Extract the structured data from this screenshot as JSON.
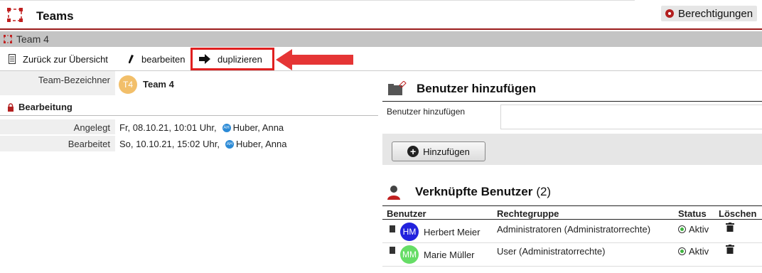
{
  "header": {
    "title": "Teams",
    "permissions_label": "Berechtigungen"
  },
  "breadcrumb": {
    "title": "Team 4"
  },
  "toolbar": {
    "back_label": "Zurück zur Übersicht",
    "edit_label": "bearbeiten",
    "duplicate_label": "duplizieren"
  },
  "team": {
    "label": "Team-Bezeichner",
    "badge": "T4",
    "name": "Team 4"
  },
  "editing": {
    "section_title": "Bearbeitung",
    "created_label": "Angelegt",
    "created_value": "Fr, 08.10.21, 10:01 Uhr,",
    "created_user": "Huber, Anna",
    "edited_label": "Bearbeitet",
    "edited_value": "So, 10.10.21, 15:02 Uhr,",
    "edited_user": "Huber, Anna",
    "avatar_initials": "AH"
  },
  "add_user": {
    "heading": "Benutzer hinzufügen",
    "field_label": "Benutzer hinzufügen",
    "input_value": "",
    "button_label": "Hinzufügen"
  },
  "linked_users": {
    "heading": "Verknüpfte Benutzer",
    "count": "(2)",
    "columns": [
      "Benutzer",
      "Rechtegruppe",
      "Status",
      "Löschen"
    ],
    "rows": [
      {
        "initials": "HM",
        "name": "Herbert Meier",
        "group": "Administratoren (Administratorrechte)",
        "status": "Aktiv",
        "color": "#2222dd"
      },
      {
        "initials": "MM",
        "name": "Marie Müller",
        "group": "User (Administratorrechte)",
        "status": "Aktiv",
        "color": "#66dd66"
      }
    ]
  },
  "colors": {
    "accent": "#9b1c1c",
    "highlight": "#e02020"
  }
}
